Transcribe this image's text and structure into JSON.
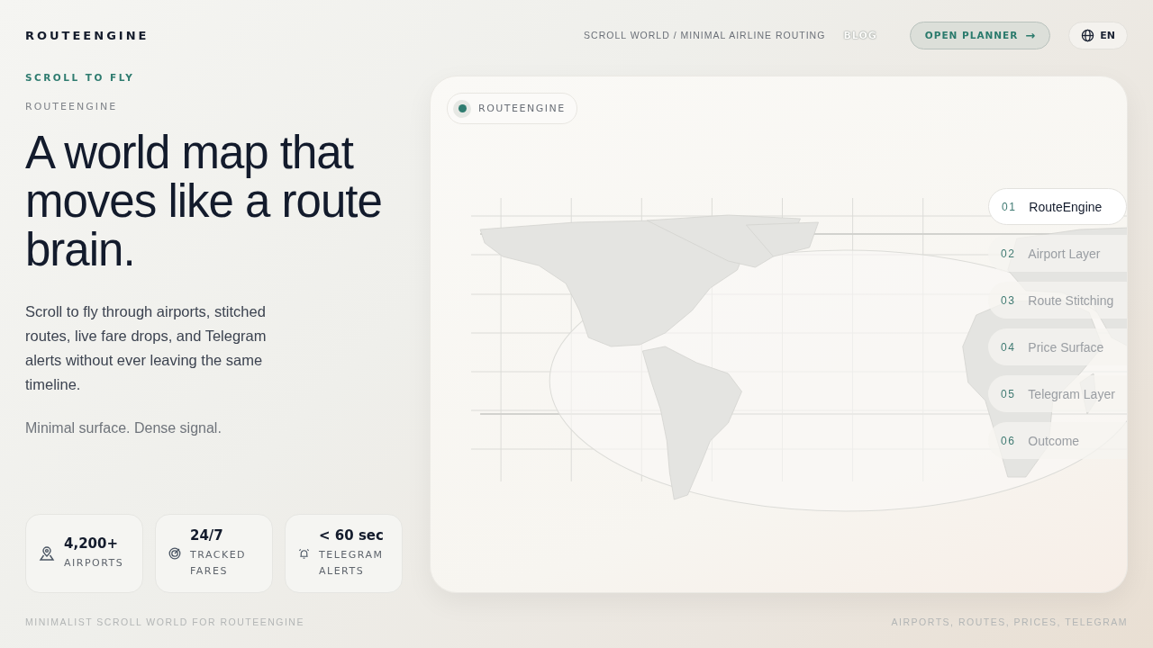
{
  "brand": "ROUTEENGINE",
  "nav": {
    "tagline": "SCROLL WORLD / MINIMAL AIRLINE ROUTING",
    "blog": "BLOG",
    "cta": "OPEN PLANNER",
    "cta_arrow": "→",
    "language": "EN"
  },
  "hero": {
    "eyebrow": "SCROLL TO FLY",
    "kicker": "ROUTEENGINE",
    "title": "A world map that moves like a route brain.",
    "body": "Scroll to fly through airports, stitched routes, live fare drops, and Telegram alerts without ever leaving the same timeline.",
    "note": "Minimal surface. Dense signal."
  },
  "stats": [
    {
      "value": "4,200+",
      "label": "AIRPORTS"
    },
    {
      "value": "24/7",
      "label": "TRACKED FARES"
    },
    {
      "value": "< 60 sec",
      "label": "TELEGRAM ALERTS"
    }
  ],
  "map_card": {
    "badge": "ROUTEENGINE",
    "steps": [
      {
        "number": "01",
        "label": "RouteEngine",
        "selected": true
      },
      {
        "number": "02",
        "label": "Airport Layer",
        "selected": false
      },
      {
        "number": "03",
        "label": "Route Stitching",
        "selected": false
      },
      {
        "number": "04",
        "label": "Price Surface",
        "selected": false
      },
      {
        "number": "05",
        "label": "Telegram Layer",
        "selected": false
      },
      {
        "number": "06",
        "label": "Outcome",
        "selected": false
      }
    ]
  },
  "footer": {
    "left": "MINIMALIST SCROLL WORLD FOR ROUTEENGINE",
    "right": "AIRPORTS, ROUTES, PRICES, TELEGRAM"
  }
}
